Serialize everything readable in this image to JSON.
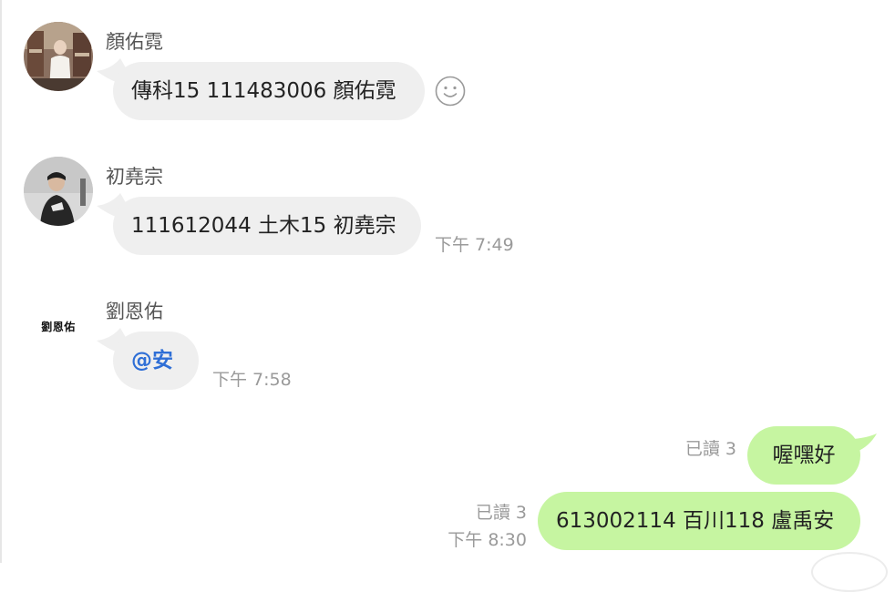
{
  "chat": {
    "messages": [
      {
        "sender": "顏佑霓",
        "text": "傳科15 111483006 顏佑霓",
        "reaction_icon": "smile-icon"
      },
      {
        "sender": "初堯宗",
        "text": "111612044 土木15 初堯宗",
        "time": "下午 7:49"
      },
      {
        "sender": "劉恩佑",
        "avatar_text": "劉恩佑",
        "mention": "@安",
        "time": "下午 7:58"
      },
      {
        "text": "喔嘿好",
        "read": "已讀 3"
      },
      {
        "text": "613002114 百川118 盧禹安",
        "read": "已讀 3",
        "time": "下午 8:30"
      }
    ]
  },
  "colors": {
    "incoming_bubble": "#efefef",
    "outgoing_bubble": "#c6f5a1",
    "mention": "#2f6fd6",
    "meta_text": "#9a9a9a"
  }
}
